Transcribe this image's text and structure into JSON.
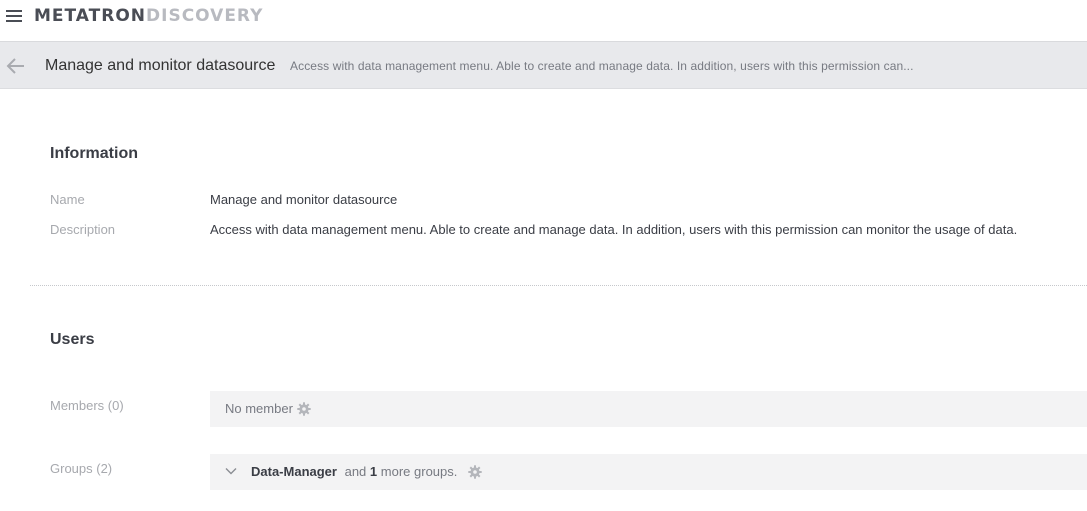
{
  "header": {
    "menu_icon": "hamburger-icon",
    "logo_part1": "METATRON",
    "logo_part2": "DISCOVERY"
  },
  "subheader": {
    "back_icon": "arrow-left-icon",
    "title": "Manage and monitor datasource",
    "description": "Access with data management menu. Able to create and manage data. In addition, users with this permission can..."
  },
  "information": {
    "section_title": "Information",
    "name_label": "Name",
    "name_value": "Manage and monitor datasource",
    "description_label": "Description",
    "description_value": "Access with data management menu. Able to create and manage data. In addition, users with this permission can monitor the usage of data."
  },
  "users": {
    "section_title": "Users",
    "members_label": "Members (0)",
    "members_value": "No member",
    "groups_label": "Groups (2)",
    "groups_first": "Data-Manager",
    "groups_and": "and",
    "groups_more_count": "1",
    "groups_more_text": "more groups."
  },
  "colors": {
    "subheader_bg": "#e8e9ec",
    "box_bg": "#f3f3f4",
    "label": "#a7a9ae",
    "text": "#3a3d45"
  }
}
